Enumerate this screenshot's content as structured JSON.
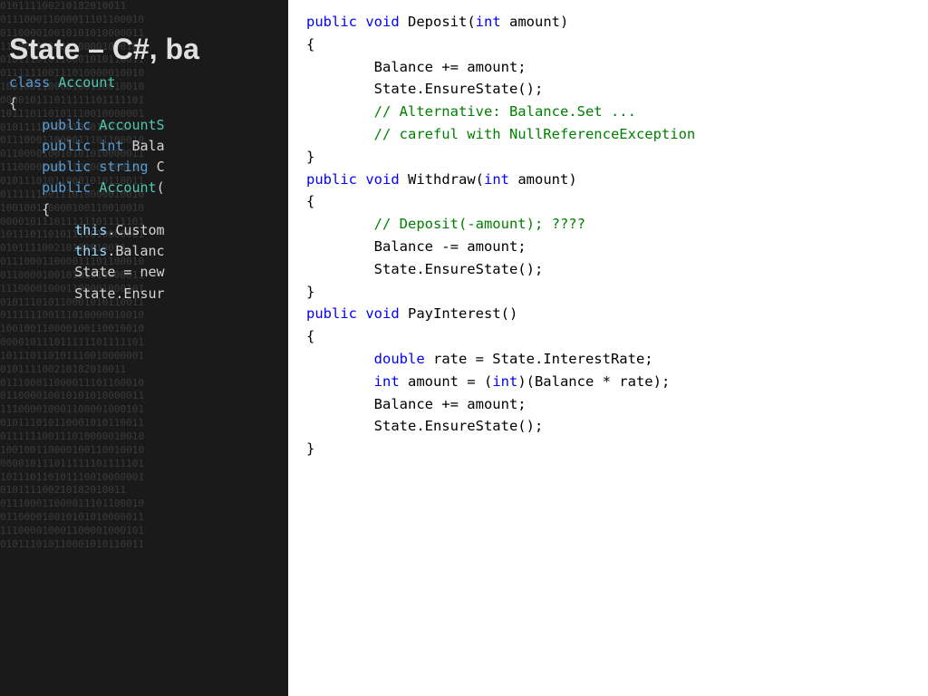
{
  "title": "State – C#, ba",
  "left": {
    "binary_lines": [
      "010111100210182010011",
      "010111100210182010011",
      "010111100210182010011",
      "011100011000011101100010",
      "011000010010101010000011",
      "111000010001100001000101",
      "010111010110001010110011",
      "011111100111010000010010",
      "100100110000100110010010",
      "000010111011111101111101",
      "101110110101110010000001"
    ],
    "class_keyword": "class",
    "class_name": "Account",
    "open_brace1": "{",
    "field1_keyword": "public",
    "field1_type": "AccountS",
    "field2_keyword": "public",
    "field2_type": "int",
    "field2_name": "Bala",
    "field3_keyword": "public",
    "field3_type": "string",
    "field3_name": "C",
    "ctor_keyword": "public",
    "ctor_name": "Account(",
    "open_brace2": "    {",
    "this1": "this",
    "this1_rest": ".Custom",
    "this2": "this",
    "this2_rest": ".Balanc",
    "state_assign": "        State = new",
    "state_ensure": "        State.Ensur",
    "close_brace": "    }"
  },
  "right": {
    "deposit_sig": "public void Deposit(int amount)",
    "deposit_open": "{",
    "deposit_line1": "        Balance += amount;",
    "deposit_line2": "        State.EnsureState();",
    "deposit_comment1": "        // Alternative: Balance.Set ...",
    "deposit_comment2": "        // careful with NullReferenceException",
    "deposit_close": "}",
    "withdraw_sig": "public void Withdraw(int amount)",
    "withdraw_open": "{",
    "withdraw_comment": "        // Deposit(-amount); ????",
    "withdraw_line1": "        Balance -= amount;",
    "withdraw_line2": "        State.EnsureState();",
    "withdraw_close": "}",
    "payinterest_sig": "public void PayInterest()",
    "payinterest_open": "{",
    "payinterest_line1": "        double rate = State.InterestRate;",
    "payinterest_line2": "        int amount = (int)(Balance * rate);",
    "payinterest_line3": "        Balance += amount;",
    "payinterest_line4": "        State.EnsureState();",
    "payinterest_close": "}"
  }
}
